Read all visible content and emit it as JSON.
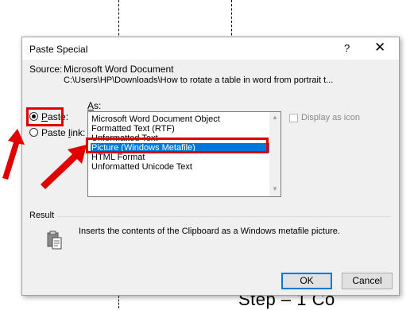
{
  "background": {
    "doc_text": "Step – 1 Co"
  },
  "dialog": {
    "title": "Paste Special",
    "help_label": "?",
    "close_label": "✕",
    "source_label": "Source:",
    "source_name": "Microsoft Word Document",
    "source_path": "C:\\Users\\HP\\Downloads\\How to rotate a table in word from portrait t...",
    "as_label": "As:",
    "paste_label": "Paste:",
    "paste_link_label": "Paste link:",
    "formats": [
      "Microsoft Word Document Object",
      "Formatted Text (RTF)",
      "Unformatted Text",
      "Picture (Windows Metafile)",
      "HTML Format",
      "Unformatted Unicode Text"
    ],
    "selected_format": "Picture (Windows Metafile)",
    "display_as_icon_label": "Display as icon",
    "result_label": "Result",
    "result_text": "Inserts the contents of the Clipboard as a Windows metafile picture.",
    "ok_label": "OK",
    "cancel_label": "Cancel"
  },
  "colors": {
    "highlight": "#e00000",
    "selection": "#0078d7"
  },
  "icons": [
    "clipboard-icon",
    "close-icon",
    "help-icon",
    "scroll-up-icon",
    "scroll-down-icon",
    "arrow-icon"
  ]
}
